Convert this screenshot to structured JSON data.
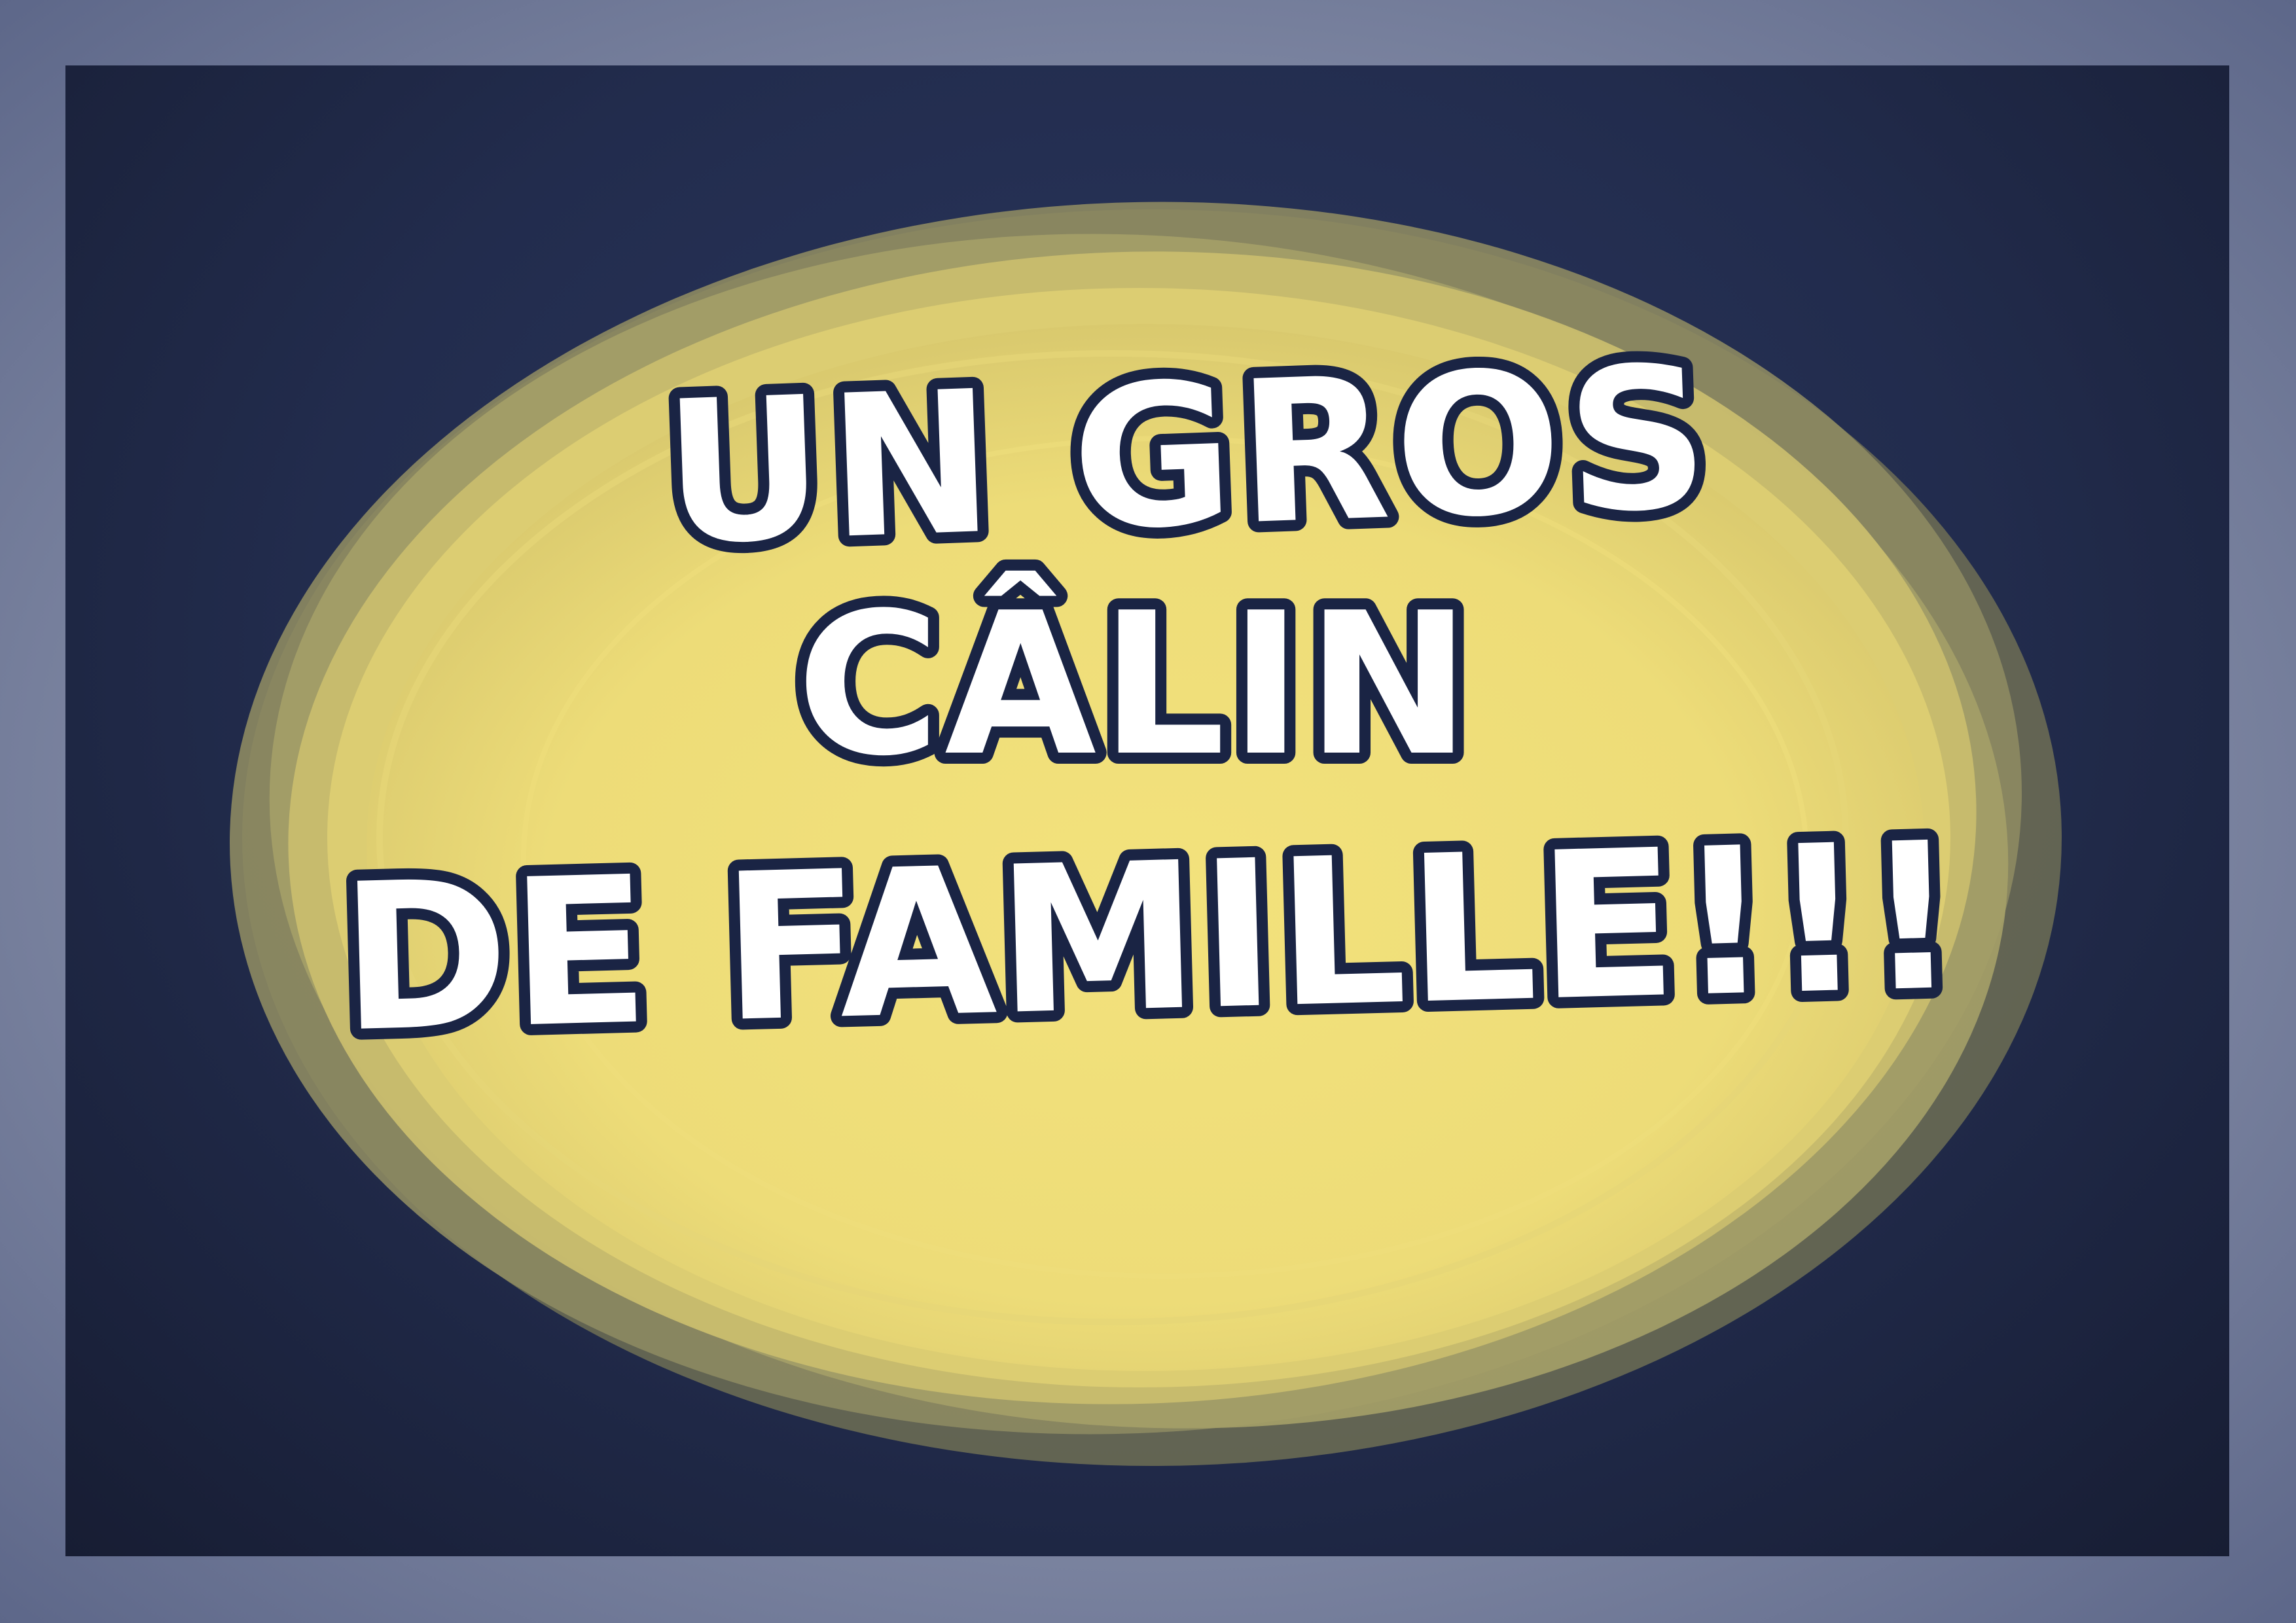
{
  "caption": {
    "line1": "UN GROS",
    "line2": "CÂLIN",
    "line3": "DE FAMILLE!!!"
  },
  "colors": {
    "outer_frame": "#8a92ab",
    "panel_background": "#222c4d",
    "bubble_fill": "#f1e07a",
    "bubble_shadow": "#8a8660",
    "text_fill": "#ffffff",
    "text_outline": "#1a2444"
  }
}
